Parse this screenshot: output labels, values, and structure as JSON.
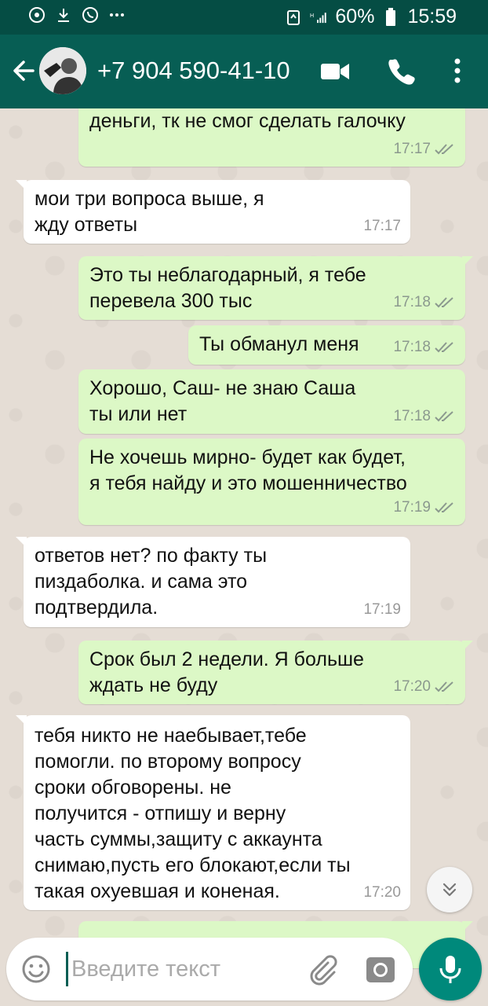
{
  "status_bar": {
    "battery": "60%",
    "time": "15:59",
    "icons": [
      "vpn-icon",
      "download-icon",
      "phone-icon",
      "more-dots-icon",
      "battery-saver-icon",
      "signal-icon",
      "battery-icon"
    ]
  },
  "header": {
    "contact": "+7 904 590-41-10",
    "icons": [
      "back-arrow-icon",
      "avatar",
      "video-call-icon",
      "voice-call-icon",
      "overflow-menu-icon"
    ]
  },
  "messages": [
    {
      "direction": "out",
      "text": "деньги, тк не смог сделать галочку",
      "time": "17:17"
    },
    {
      "direction": "in",
      "text": "мои три вопроса выше, я\nжду ответы",
      "time": "17:17"
    },
    {
      "direction": "out",
      "text": "Это ты неблагодарный, я тебе\nперевела 300 тыс",
      "time": "17:18"
    },
    {
      "direction": "out",
      "text": "Ты обманул меня",
      "time": "17:18"
    },
    {
      "direction": "out",
      "text": "Хорошо, Саш- не знаю Саша\nты или нет",
      "time": "17:18"
    },
    {
      "direction": "out",
      "text": "Не хочешь мирно- будет как будет,\nя тебя найду и это мошенничество",
      "time": "17:19"
    },
    {
      "direction": "in",
      "text": "ответов нет? по факту ты\nпиздаболка. и сама это\nподтвердила.",
      "time": "17:19"
    },
    {
      "direction": "out",
      "text": "Срок был 2 недели. Я больше\nждать не буду",
      "time": "17:20"
    },
    {
      "direction": "in",
      "text": "тебя никто не наебывает,тебе\nпомогли. по второму вопросу\nсроки обговорены. не\nполучится - отпишу и верну\nчасть суммы,защиту с аккаунта\nснимаю,пусть его блокают,если ты\nтакая охуевшая и коненая.",
      "time": "17:20"
    }
  ],
  "input": {
    "placeholder": "Введите текст",
    "value": ""
  },
  "colors": {
    "toolbar": "#075e54",
    "status_bar": "#054d44",
    "outgoing_bubble": "#dcf8c6",
    "incoming_bubble": "#ffffff",
    "read_ticks": "#8b998e",
    "mic_button": "#00897b"
  }
}
